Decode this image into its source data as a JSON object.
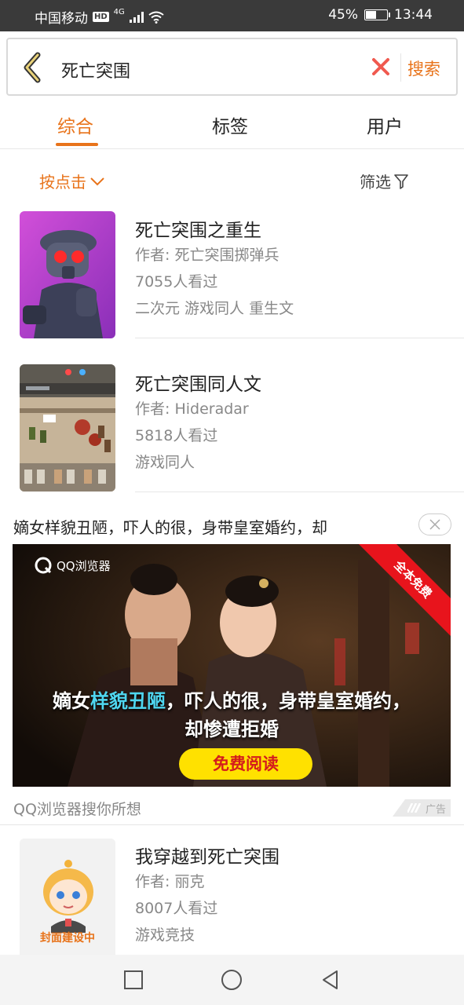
{
  "status_bar": {
    "carrier": "中国移动",
    "hd_label": "HD",
    "network": "4G",
    "battery": "45%",
    "battery_level": 0.45,
    "time": "13:44"
  },
  "search": {
    "query": "死亡突围",
    "button_label": "搜索"
  },
  "tabs": [
    {
      "label": "综合",
      "active": true
    },
    {
      "label": "标签",
      "active": false
    },
    {
      "label": "用户",
      "active": false
    }
  ],
  "filters": {
    "sort_label": "按点击",
    "filter_label": "筛选"
  },
  "books": [
    {
      "title": "死亡突围之重生",
      "author": "作者: 死亡突围掷弹兵",
      "views": "7055人看过",
      "tags": "二次元 游戏同人 重生文"
    },
    {
      "title": "死亡突围同人文",
      "author": "作者: Hideradar",
      "views": "5818人看过",
      "tags": "游戏同人"
    },
    {
      "title": "我穿越到死亡突围",
      "author": "作者: 丽克",
      "views": "8007人看过",
      "tags": "游戏竞技",
      "cover_label": "封面建设中"
    }
  ],
  "ad": {
    "headline": "嫡女样貌丑陋，吓人的很，身带皇室婚约，却",
    "logo_text": "QQ浏览器",
    "ribbon": "全本免费",
    "caption_prefix": "嫡女",
    "caption_highlight": "样貌丑陋",
    "caption_rest": "，吓人的很，身带皇室婚约，",
    "caption_line2": "却惨遭拒婚",
    "cta": "免费阅读",
    "source": "QQ浏览器搜你所想",
    "tag": "广告"
  },
  "colors": {
    "accent": "#e8731a",
    "status_bar": "#3a3a3a",
    "ad_cta": "#ffe100",
    "ad_ribbon": "#e8141c"
  }
}
